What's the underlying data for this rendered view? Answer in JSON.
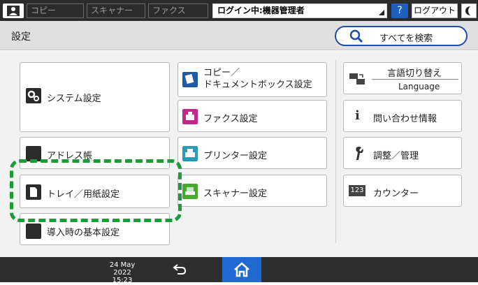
{
  "topbar": {
    "tabs": [
      "コピー",
      "スキャナー",
      "ファクス"
    ],
    "login_status": "ログイン中:機器管理者",
    "help_label": "?",
    "logout_label": "ログアウト",
    "night_label": "("
  },
  "header": {
    "title": "設定",
    "search_label": "すべてを検索"
  },
  "left_col": {
    "system": "システム設定",
    "address": "アドレス帳",
    "tray": "トレイ／用紙設定",
    "initial": "導入時の基本設定"
  },
  "mid_col": {
    "copy_line1": "コピー／",
    "copy_line2": "ドキュメントボックス設定",
    "fax": "ファクス設定",
    "printer": "プリンター設定",
    "scanner": "スキャナー設定"
  },
  "right_col": {
    "language_top": "言語切り替え",
    "language_bottom": "Language",
    "inquiry": "問い合わせ情報",
    "adjust": "調整／管理",
    "counter": "カウンター",
    "counter_icon": "123"
  },
  "bottom": {
    "date": "24 May 2022",
    "time": "15:23"
  },
  "colors": {
    "accent": "#1f6ad1",
    "highlight": "#1b9b3a",
    "copy_icon": "#1e5aa6",
    "fax_icon": "#c2288a",
    "printer_icon": "#2a9bb3",
    "scanner_icon": "#49a82f"
  }
}
